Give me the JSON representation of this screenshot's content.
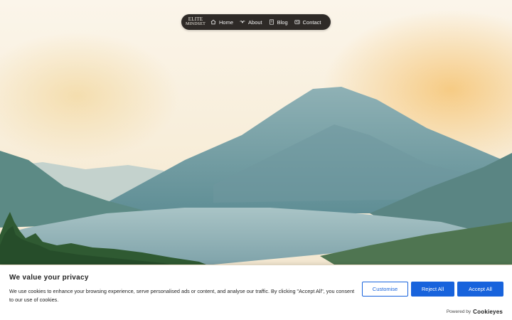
{
  "nav": {
    "logo_line1": "ELITE",
    "logo_line2": "MINDSET",
    "items": [
      {
        "label": "Home",
        "icon": "home-icon"
      },
      {
        "label": "About",
        "icon": "handshake-icon"
      },
      {
        "label": "Blog",
        "icon": "book-icon"
      },
      {
        "label": "Contact",
        "icon": "contact-card-icon"
      }
    ]
  },
  "cookie": {
    "title": "We value your privacy",
    "text": "We use cookies to enhance your browsing experience, serve personalised ads or content, and analyse our traffic. By clicking \"Accept All\", you consent to our use of cookies.",
    "customise_label": "Customise",
    "reject_label": "Reject All",
    "accept_label": "Accept All",
    "powered_prefix": "Powered by",
    "powered_brand": "Cookieyes",
    "accent": "#1863dc"
  }
}
